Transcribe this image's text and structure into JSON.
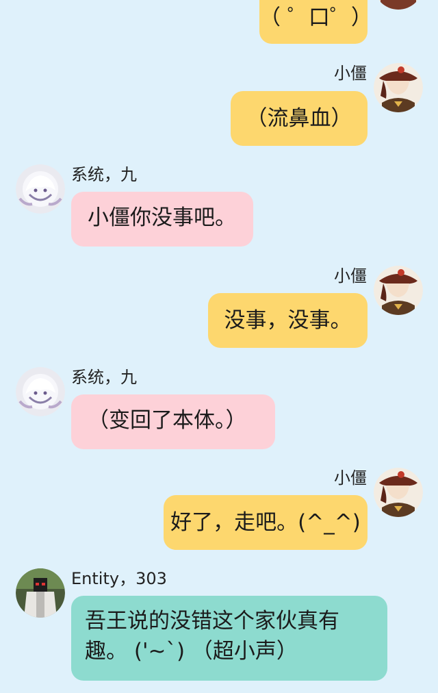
{
  "chat": {
    "messages": [
      {
        "sender": "",
        "side": "right",
        "text": "（ ゜口゜）"
      },
      {
        "sender": "小僵",
        "side": "right",
        "text": "（流鼻血）"
      },
      {
        "sender": "系统，九",
        "side": "left",
        "text": "小僵你没事吧。"
      },
      {
        "sender": "小僵",
        "side": "right",
        "text": "没事，没事。"
      },
      {
        "sender": "系统，九",
        "side": "left",
        "text": "（变回了本体。）"
      },
      {
        "sender": "小僵",
        "side": "right",
        "text": "好了，走吧。(^_^)"
      },
      {
        "sender": "Entity，303",
        "side": "left",
        "text": "吾王说的没错这个家伙真有趣。 ('~`) （超小声）"
      }
    ]
  },
  "colors": {
    "background": "#dff1fb",
    "right_bubble": "#fdd76e",
    "system_bubble": "#fdd1d8",
    "entity_bubble": "#8ddbcf"
  },
  "icons": {
    "xiaojiang_avatar": "xiaojiang-avatar-icon",
    "system_avatar": "system-nine-avatar-icon",
    "entity_avatar": "entity-303-avatar-icon"
  }
}
